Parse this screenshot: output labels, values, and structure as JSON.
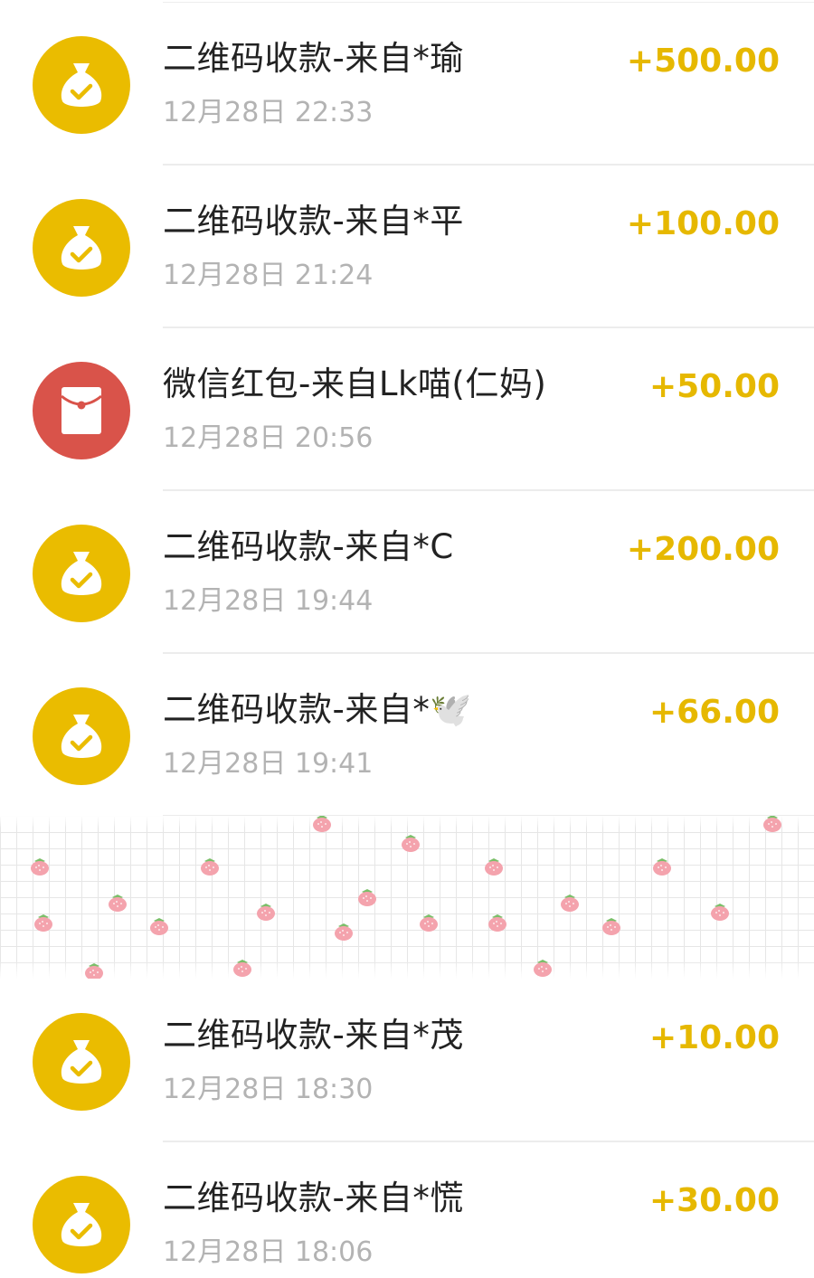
{
  "colors": {
    "amount": "#e6b800",
    "qr_icon_bg": "#eabc00",
    "red_packet_icon_bg": "#d9534a",
    "title": "#222222",
    "time": "#b3b3b3"
  },
  "transactions": [
    {
      "icon": "money-bag-check-icon",
      "title": "二维码收款-来自*瑜",
      "time": "12月28日 22:33",
      "amount": "+500.00"
    },
    {
      "icon": "money-bag-check-icon",
      "title": "二维码收款-来自*平",
      "time": "12月28日 21:24",
      "amount": "+100.00"
    },
    {
      "icon": "red-packet-icon",
      "title": "微信红包-来自Lk喵(仁妈)",
      "time": "12月28日 20:56",
      "amount": "+50.00"
    },
    {
      "icon": "money-bag-check-icon",
      "title": "二维码收款-来自*C",
      "time": "12月28日 19:44",
      "amount": "+200.00"
    },
    {
      "icon": "money-bag-check-icon",
      "title": "二维码收款-来自*🕊️",
      "time": "12月28日 19:41",
      "amount": "+66.00"
    },
    {
      "icon": "money-bag-check-icon",
      "title": "二维码收款-来自*茂",
      "time": "12月28日 18:30",
      "amount": "+10.00"
    },
    {
      "icon": "money-bag-check-icon",
      "title": "二维码收款-来自*慌",
      "time": "12月28日 18:06",
      "amount": "+30.00"
    }
  ],
  "overlay": {
    "icon": "strawberry-sticker-icon"
  }
}
